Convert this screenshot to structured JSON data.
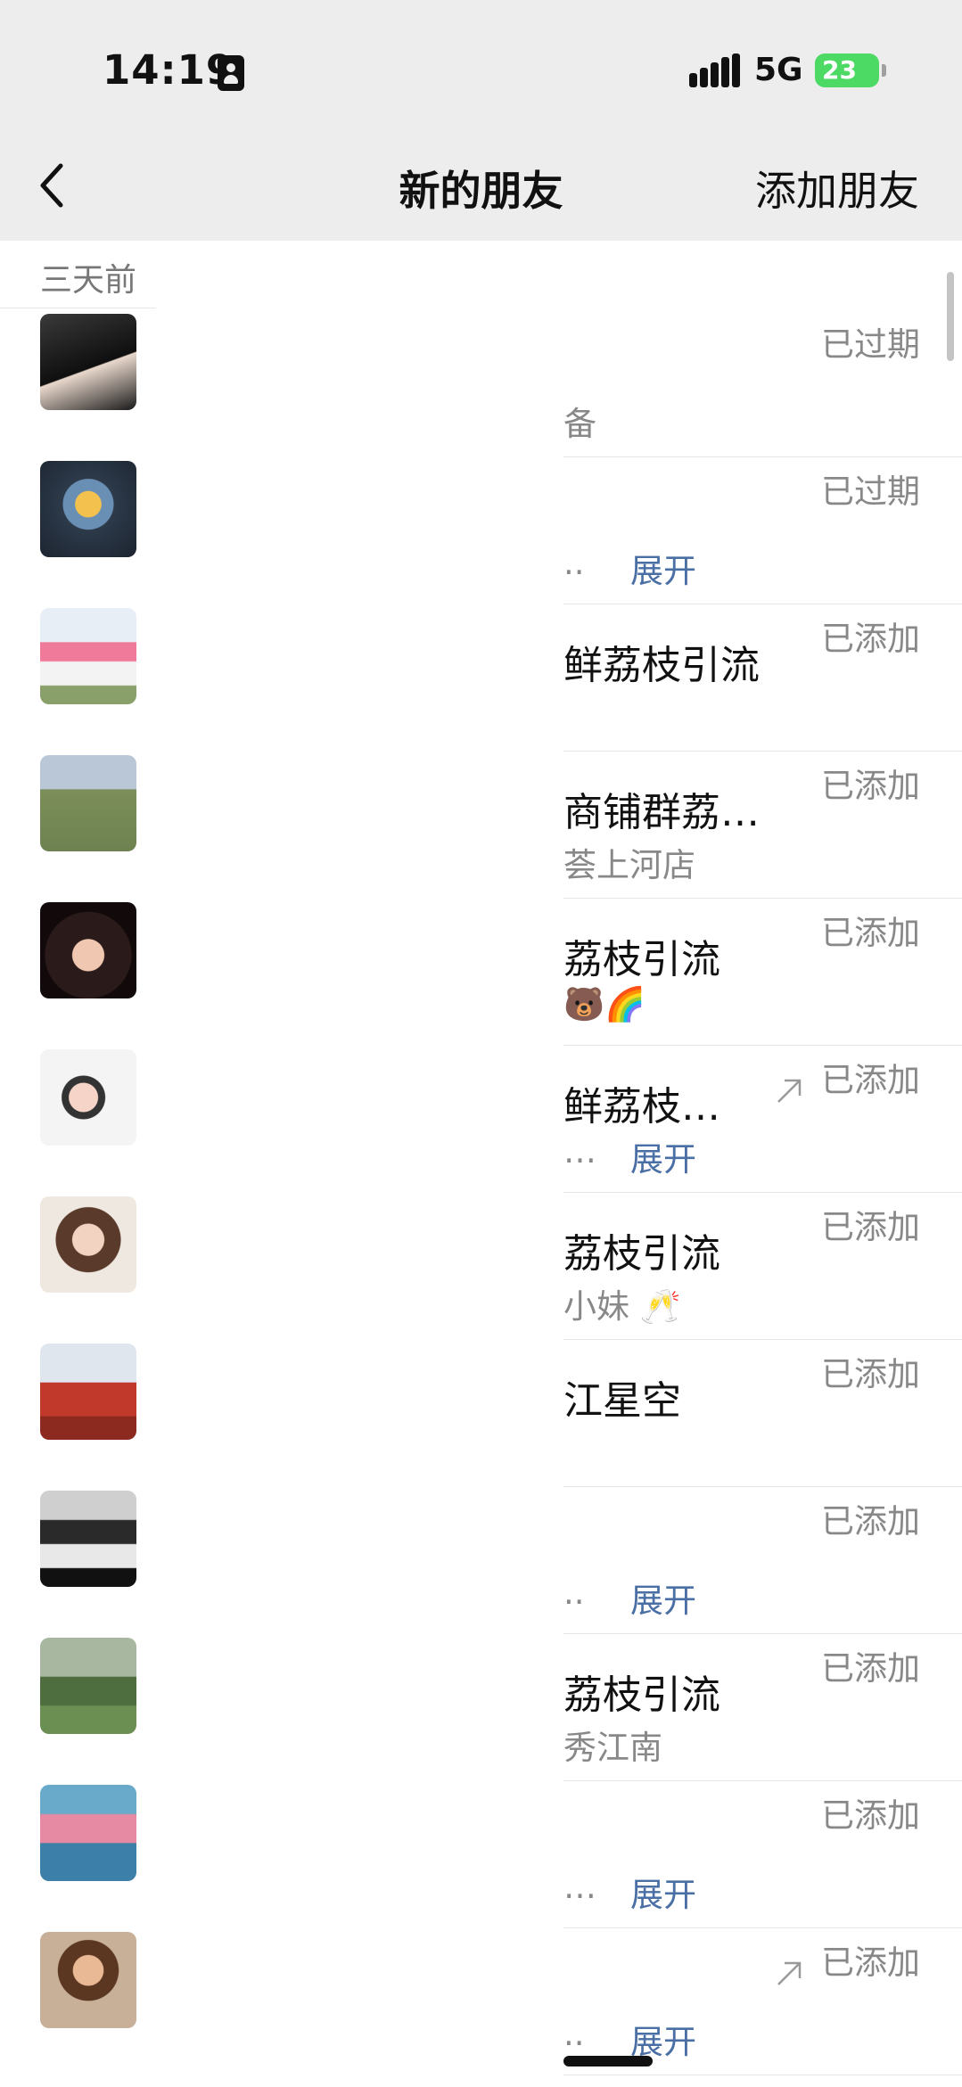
{
  "status_bar": {
    "time": "14:19",
    "network": "5G",
    "battery": "23"
  },
  "nav": {
    "title": "新的朋友",
    "add_label": "添加朋友"
  },
  "section": "三天前",
  "colors": {
    "expand_link": "#4a6fa5",
    "status_text": "#888888",
    "header_bg": "#ededed"
  },
  "rows": [
    {
      "name": "",
      "sub": "备",
      "expand": "",
      "status": "已过期",
      "arrow": false
    },
    {
      "name": "",
      "sub": "..",
      "expand": "展开",
      "status": "已过期",
      "arrow": false
    },
    {
      "name": "鲜荔枝引流",
      "sub": "",
      "expand": "",
      "status": "已添加",
      "arrow": false
    },
    {
      "name": " 商铺群荔…",
      "sub": "荟上河店",
      "expand": "",
      "status": "已添加",
      "arrow": false
    },
    {
      "name": "荔枝引流",
      "sub": "🐻🌈",
      "expand": "",
      "status": "已添加",
      "arrow": false
    },
    {
      "name": "鲜荔枝…",
      "sub": "…",
      "expand": "展开",
      "status": "已添加",
      "arrow": true
    },
    {
      "name": "荔枝引流",
      "sub": "小妹 🥂",
      "expand": "",
      "status": "已添加",
      "arrow": false
    },
    {
      "name": "江星空",
      "sub": "",
      "expand": "",
      "status": "已添加",
      "arrow": false
    },
    {
      "name": "",
      "sub": "..",
      "expand": "展开",
      "status": "已添加",
      "arrow": false
    },
    {
      "name": "荔枝引流",
      "sub": "秀江南",
      "expand": "",
      "status": "已添加",
      "arrow": false
    },
    {
      "name": "",
      "sub": "…",
      "expand": "展开",
      "status": "已添加",
      "arrow": false
    },
    {
      "name": "",
      "sub": "..",
      "expand": "展开",
      "status": "已添加",
      "arrow": true
    }
  ]
}
